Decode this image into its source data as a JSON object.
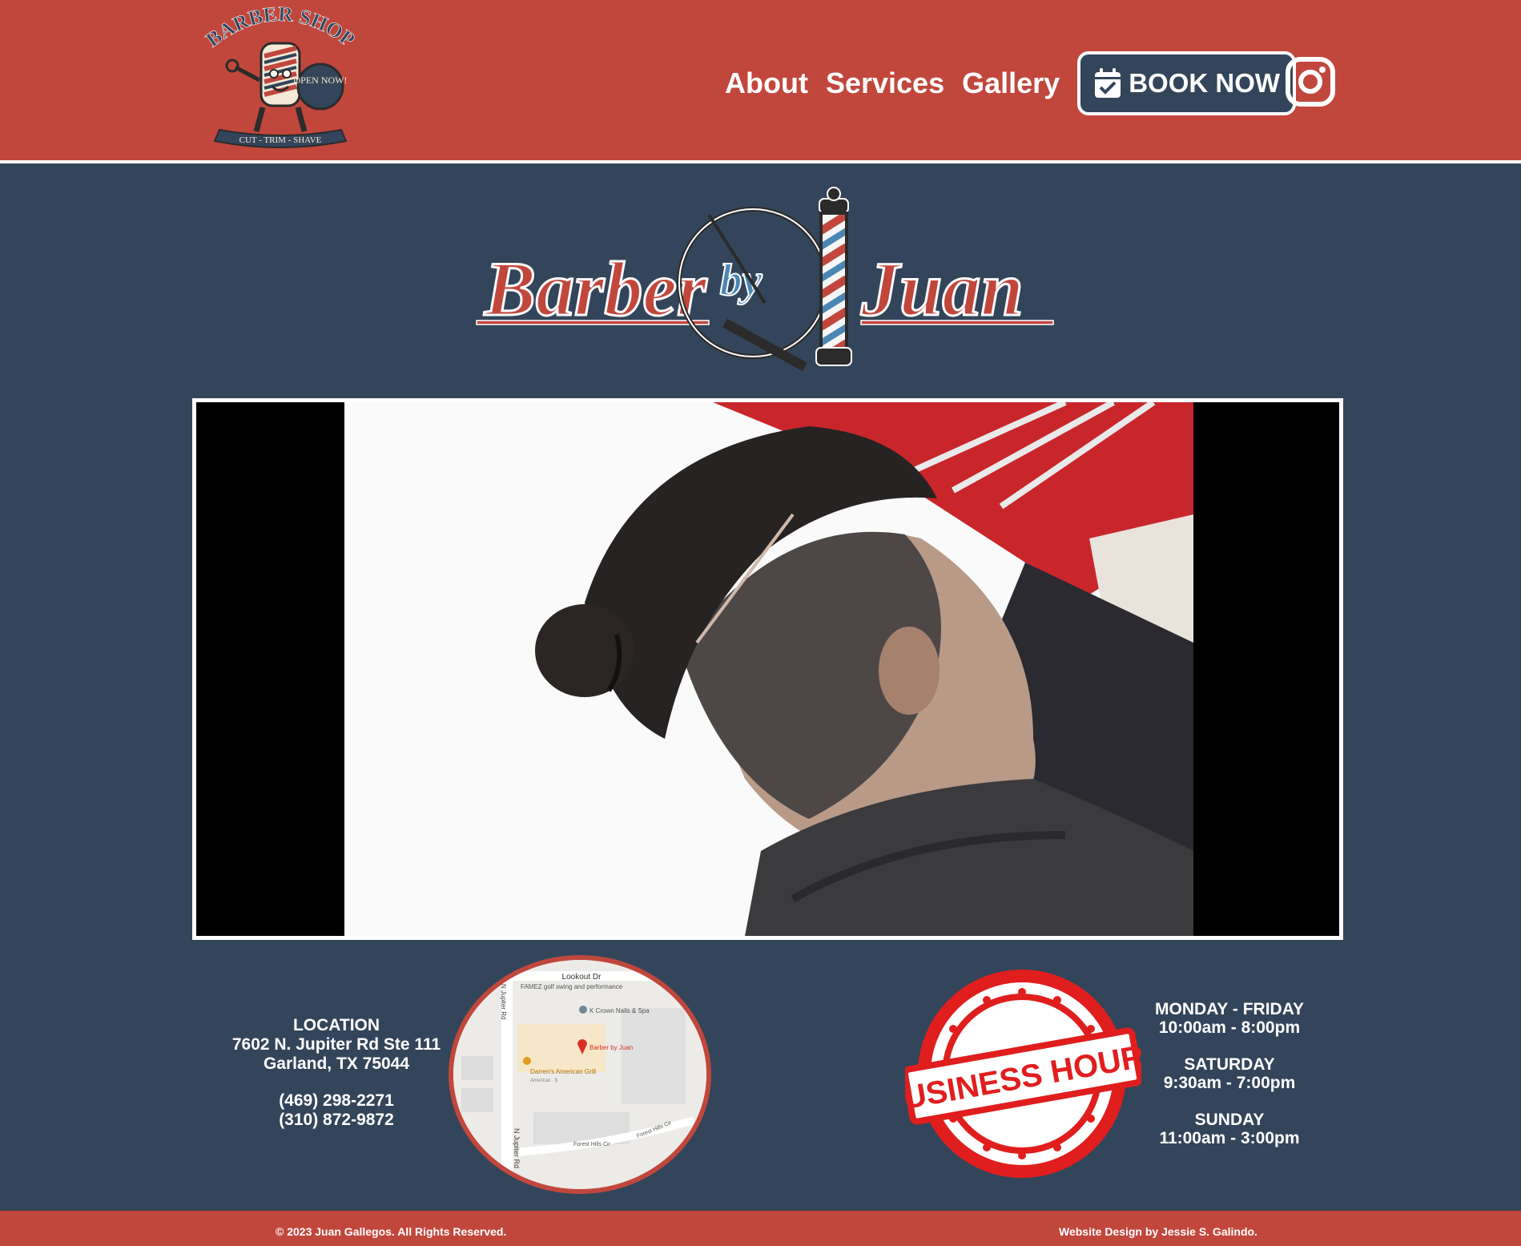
{
  "colors": {
    "header_bg": "#c1473d",
    "page_bg": "#33455a",
    "accent_blue": "#4a86b3",
    "text": "#ffffff"
  },
  "shop_logo": {
    "title": "BARBER SHOP",
    "badge": "OPEN NOW!",
    "banner": "CUT - TRIM - SHAVE"
  },
  "nav": {
    "items": [
      "About",
      "Services",
      "Gallery"
    ],
    "book_label": "BOOK NOW",
    "book_icon": "calendar-check-icon",
    "social_icon": "instagram-icon"
  },
  "brand": {
    "word1": "Barber",
    "word2": "by",
    "word3": "Juan"
  },
  "video": {
    "description_icon": "video-player"
  },
  "location": {
    "heading": "LOCATION",
    "address_line1": "7602 N. Jupiter Rd Ste 111",
    "address_line2": "Garland, TX 75044",
    "phone1": "(469) 298-2271",
    "phone2": "(310) 872-9872"
  },
  "map": {
    "road_top": "Lookout Dr",
    "poi1": "FAMEZ golf swing and performance",
    "poi2": "K Crown Nails & Spa",
    "pin": "Barber by Juan",
    "poi3": "Darren's American Grill",
    "poi3_sub": "American · $",
    "road_left": "N Jupiter Rd",
    "road_left2": "N Jupiter Rd",
    "road_bottom": "Forest Hills Cir",
    "road_bottom2": "Forest Hills Cir"
  },
  "stamp": {
    "text": "BUSINESS HOURS"
  },
  "hours": {
    "weekday_label": "MONDAY - FRIDAY",
    "weekday_time": "10:00am - 8:00pm",
    "saturday_label": "SATURDAY",
    "saturday_time": "9:30am - 7:00pm",
    "sunday_label": "SUNDAY",
    "sunday_time": "11:00am - 3:00pm"
  },
  "footer": {
    "copyright": "© 2023 Juan Gallegos. All Rights Reserved.",
    "credit": "Website Design by Jessie S. Galindo."
  }
}
